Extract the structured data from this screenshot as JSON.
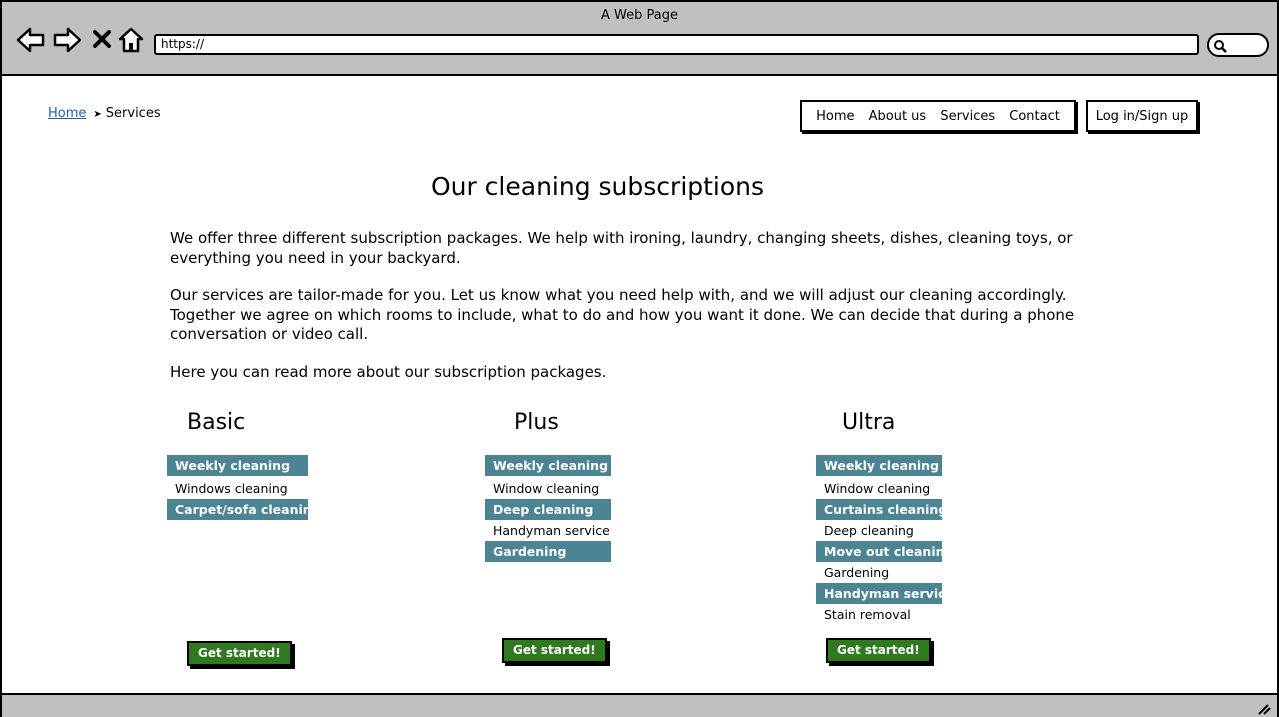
{
  "window": {
    "title": "A Web Page",
    "url": "https://",
    "icons": [
      "back-arrow-icon",
      "forward-arrow-icon",
      "close-x-icon",
      "home-icon",
      "search-icon",
      "resize-grip-icon"
    ]
  },
  "breadcrumb": {
    "home": "Home",
    "current": "Services"
  },
  "nav": {
    "items": [
      "Home",
      "About us",
      "Services",
      "Contact"
    ],
    "login": "Log in/Sign up"
  },
  "page": {
    "title": "Our cleaning subscriptions",
    "paragraphs": [
      "We offer three different subscription packages. We help with ironing, laundry, changing sheets, dishes, cleaning toys, or everything you need in your backyard.",
      "Our services are tailor-made for you. Let us know what you need help with, and we will adjust our cleaning accordingly. Together we agree on which rooms to include, what to do and how you want it done. We can decide that during a phone conversation or video call.",
      "Here you can read more about our subscription packages."
    ]
  },
  "plans": [
    {
      "name": "Basic",
      "features": [
        {
          "label": "Weekly cleaning",
          "highlight": true
        },
        {
          "label": "Windows cleaning",
          "highlight": false
        },
        {
          "label": "Carpet/sofa cleaning",
          "highlight": true
        }
      ],
      "button": "Get started!"
    },
    {
      "name": "Plus",
      "features": [
        {
          "label": "Weekly cleaning",
          "highlight": true
        },
        {
          "label": "Window cleaning",
          "highlight": false
        },
        {
          "label": "Deep cleaning",
          "highlight": true
        },
        {
          "label": "Handyman service",
          "highlight": false
        },
        {
          "label": "Gardening",
          "highlight": true
        }
      ],
      "button": "Get started!"
    },
    {
      "name": "Ultra",
      "features": [
        {
          "label": "Weekly cleaning",
          "highlight": true
        },
        {
          "label": "Window cleaning",
          "highlight": false
        },
        {
          "label": "Curtains cleaning",
          "highlight": true
        },
        {
          "label": "Deep cleaning",
          "highlight": false
        },
        {
          "label": "Move out cleaning",
          "highlight": true
        },
        {
          "label": "Gardening",
          "highlight": false
        },
        {
          "label": "Handyman service",
          "highlight": true
        },
        {
          "label": "Stain removal",
          "highlight": false
        }
      ],
      "button": "Get started!"
    }
  ],
  "colors": {
    "chrome": "#c0c0c0",
    "feature_highlight": "#4d8494",
    "button": "#2f7a1e",
    "link": "#1f5fa8"
  }
}
